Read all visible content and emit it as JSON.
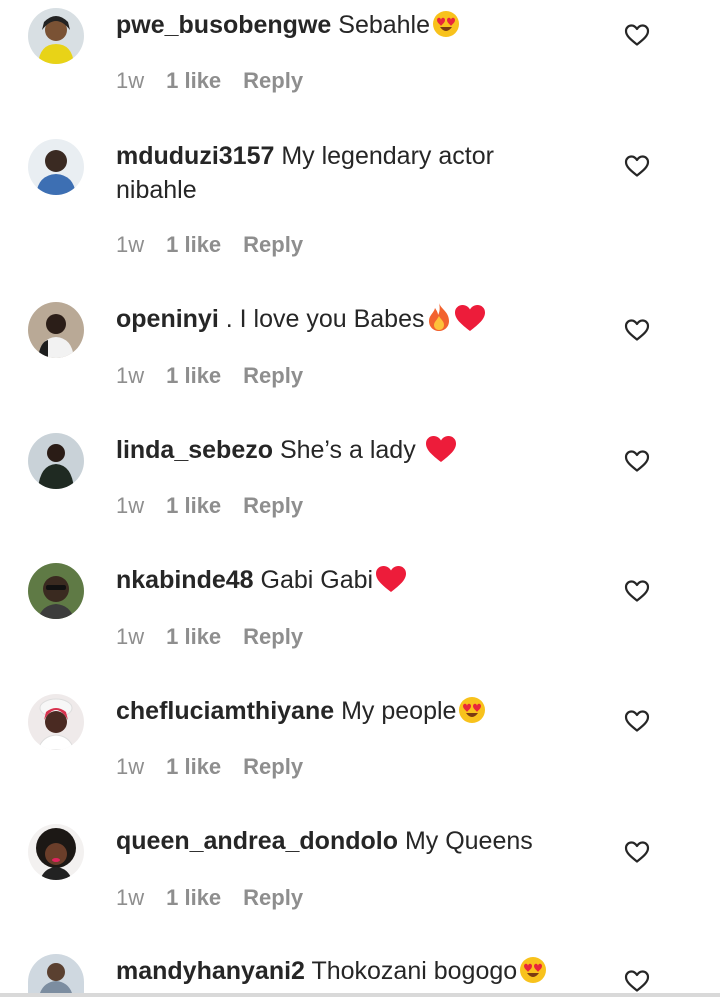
{
  "comments": [
    {
      "username": "pwe_busobengwe",
      "text": "Sebahle",
      "emoji": "heart-eyes",
      "time": "1w",
      "likes": "1 like",
      "reply": "Reply",
      "avatar_color": "#c9a227"
    },
    {
      "username": "mduduzi3157",
      "text": "My legendary actor nibahle",
      "emoji": "",
      "time": "1w",
      "likes": "1 like",
      "reply": "Reply",
      "avatar_color": "#3d6fb3"
    },
    {
      "username": "openinyi",
      "text": ". I love you Babes",
      "emoji": "fire-heart",
      "time": "1w",
      "likes": "1 like",
      "reply": "Reply",
      "avatar_color": "#6b5a4a"
    },
    {
      "username": "linda_sebezo",
      "text": "She’s a lady",
      "emoji": "red-heart",
      "time": "1w",
      "likes": "1 like",
      "reply": "Reply",
      "avatar_color": "#2f3a2f"
    },
    {
      "username": "nkabinde48",
      "text": "Gabi Gabi",
      "emoji": "red-heart",
      "time": "1w",
      "likes": "1 like",
      "reply": "Reply",
      "avatar_color": "#5f7a45"
    },
    {
      "username": "chefluciamthiyane",
      "text": "My people",
      "emoji": "heart-eyes",
      "time": "1w",
      "likes": "1 like",
      "reply": "Reply",
      "avatar_color": "#d5d0d0"
    },
    {
      "username": "queen_andrea_dondolo",
      "text": "My Queens",
      "emoji": "",
      "time": "1w",
      "likes": "1 like",
      "reply": "Reply",
      "avatar_color": "#2a2420"
    },
    {
      "username": "mandyhanyani2",
      "text": "Thokozani bogogo",
      "emoji": "heart-eyes",
      "time": "",
      "likes": "",
      "reply": "",
      "avatar_color": "#7c8da0"
    }
  ],
  "colors": {
    "text": "#262626",
    "secondary": "#8e8e8e",
    "heart_red": "#ed1c3a"
  },
  "icons": {
    "like": "heart-outline-icon",
    "fire": "fire-emoji",
    "heart": "red-heart-emoji",
    "heart_eyes": "heart-eyes-emoji"
  }
}
